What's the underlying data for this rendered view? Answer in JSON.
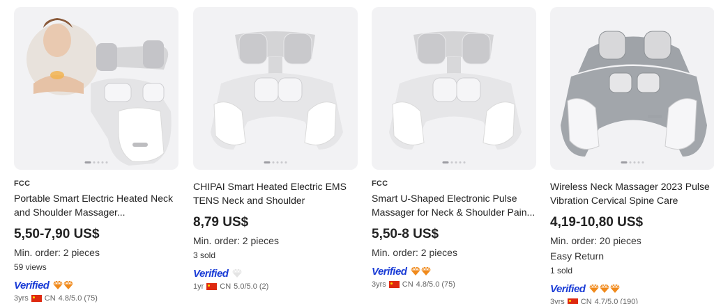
{
  "products": [
    {
      "badge": "FCC",
      "title": "Portable Smart Electric Heated Neck and Shoulder Massager...",
      "price": "5,50-7,90 US$",
      "min_order": "Min. order: 2 pieces",
      "extra": "",
      "meta": "59 views",
      "verified": "Verified",
      "diamonds": "gold",
      "diamond_count": 2,
      "years": "3yrs",
      "country": "CN",
      "rating": "4.8/5.0 (75)"
    },
    {
      "badge": "",
      "title": "CHIPAI Smart Heated Electric EMS TENS Neck and Shoulder Massager...",
      "price": "8,79 US$",
      "min_order": "Min. order: 2 pieces",
      "extra": "",
      "meta": "3 sold",
      "verified": "Verified",
      "diamonds": "grey",
      "diamond_count": 1,
      "years": "1yr",
      "country": "CN",
      "rating": "5.0/5.0 (2)"
    },
    {
      "badge": "FCC",
      "title": "Smart U-Shaped Electronic Pulse Massager for Neck & Shoulder Pain...",
      "price": "5,50-8 US$",
      "min_order": "Min. order: 2 pieces",
      "extra": "",
      "meta": "",
      "verified": "Verified",
      "diamonds": "gold",
      "diamond_count": 2,
      "years": "3yrs",
      "country": "CN",
      "rating": "4.8/5.0 (75)"
    },
    {
      "badge": "",
      "title": "Wireless Neck Massager 2023 Pulse Vibration Cervical Spine Care Health...",
      "price": "4,19-10,80 US$",
      "min_order": "Min. order: 20 pieces",
      "extra": "Easy Return",
      "meta": "1 sold",
      "verified": "Verified",
      "diamonds": "gold",
      "diamond_count": 3,
      "years": "3yrs",
      "country": "CN",
      "rating": "4.7/5.0 (190)"
    }
  ],
  "colors": {
    "verified": "#1a3cd6",
    "diamond_gold": "#f08a1c",
    "diamond_grey": "#d4d4d4",
    "image_bg": "#f2f2f4"
  }
}
